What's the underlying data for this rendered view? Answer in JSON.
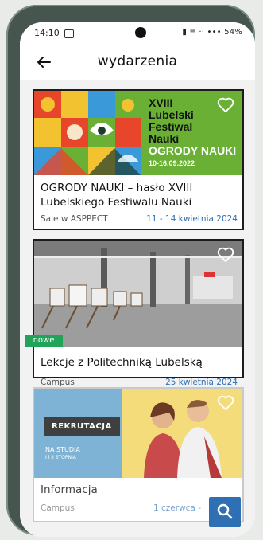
{
  "status": {
    "time": "14:10",
    "right_text": "▮ ≡ ·· ••• 54%"
  },
  "header": {
    "title": "wydarzenia"
  },
  "cards": [
    {
      "banner": {
        "line1": "XVIII",
        "line2": "Lubelski",
        "line3": "Festiwal",
        "line4": "Nauki",
        "line5": "OGRODY NAUKI",
        "date": "10-16.09.2022"
      },
      "title_line1": "OGRODY NAUKI – hasło XVIII",
      "title_line2": "Lubelskiego Festiwalu Nauki",
      "location": "Sale w ASPPECT",
      "date": "11 - 14 kwietnia 2024"
    },
    {
      "title_line1": "Lekcje z Politechniką Lubelską",
      "location": "Campus",
      "date": "25 kwietnia 2024"
    },
    {
      "banner": {
        "button": "REKRUTACJA",
        "line1": "NA STUDIA",
        "line2": "I i II STOPNIA"
      },
      "badge": "nowe",
      "title_line1": "Informacja",
      "location": "Campus",
      "date": "1 czerwca -"
    }
  ],
  "colors": {
    "accent": "#2f6fb3",
    "badge": "#22a35a",
    "festival_green": "#6ab035"
  }
}
